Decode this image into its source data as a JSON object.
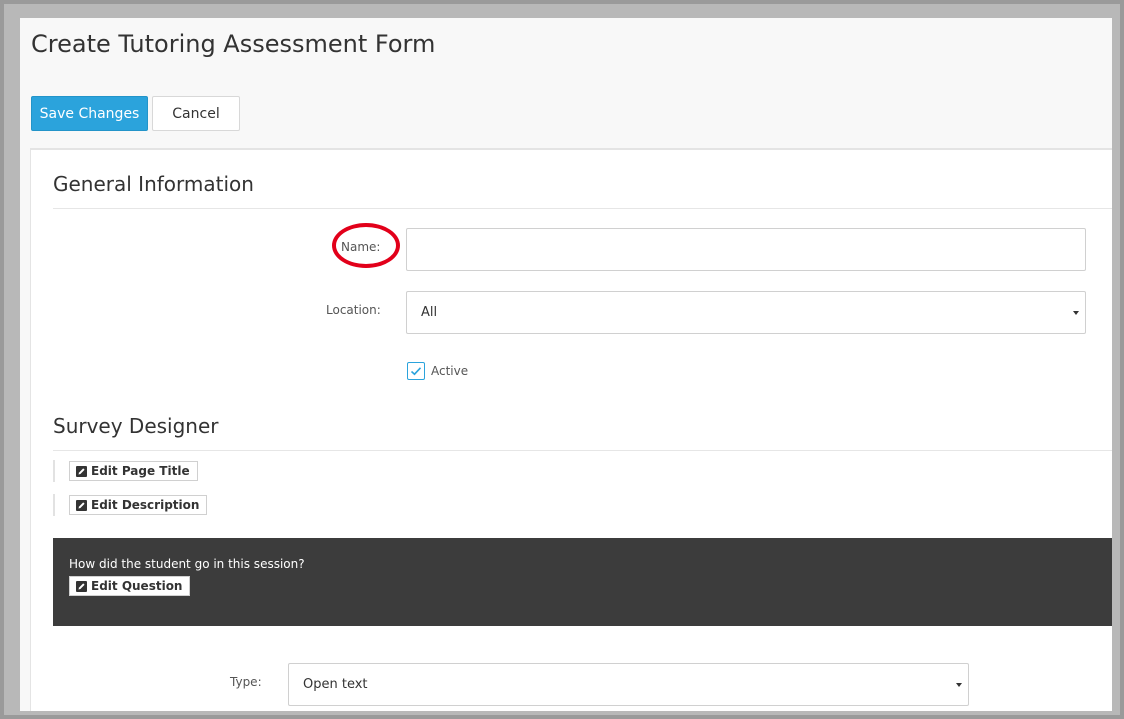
{
  "page": {
    "title": "Create Tutoring Assessment Form"
  },
  "toolbar": {
    "save_label": "Save Changes",
    "cancel_label": "Cancel"
  },
  "general": {
    "heading": "General Information",
    "name_label": "Name:",
    "name_value": "",
    "location_label": "Location:",
    "location_value": "All",
    "active_label": "Active",
    "active_checked": true
  },
  "designer": {
    "heading": "Survey Designer",
    "edit_page_title_label": "Edit Page Title",
    "edit_description_label": "Edit Description",
    "question_text": "How did the student go in this session?",
    "edit_question_label": "Edit Question",
    "type_label": "Type:",
    "type_value": "Open text"
  },
  "icons": {
    "pencil": "pencil-icon",
    "check": "check-icon",
    "caret": "caret-down-icon"
  },
  "colors": {
    "primary": "#2ba3dc",
    "question_bg": "#3c3c3c",
    "annotation": "#e2001a"
  }
}
